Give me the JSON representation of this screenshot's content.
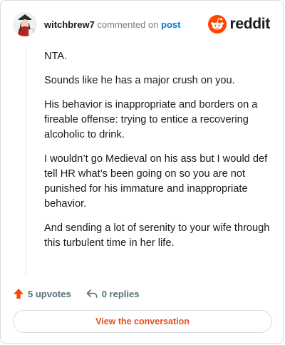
{
  "header": {
    "username": "witchbrew7",
    "verb": "commented on",
    "link": "post",
    "brand_word": "reddit"
  },
  "comment": {
    "paragraphs": [
      "NTA.",
      "Sounds like he has a major crush on you.",
      "His behavior is inappropriate and borders on a fireable offense: trying to entice a recovering alcoholic to drink.",
      "I wouldn’t go Medieval on his ass but I would def tell HR what’s been going on so you are not punished for his immature and inappropriate behavior.",
      "And sending a lot of serenity to your wife through this turbulent time in her life."
    ]
  },
  "actions": {
    "upvotes": "5 upvotes",
    "replies": "0 replies"
  },
  "cta_label": "View the conversation",
  "colors": {
    "brand": "#ff4500",
    "upvote": "#ff4500",
    "link": "#0079d3",
    "cta_text": "#e0501a"
  },
  "icons": {
    "avatar": "avatar",
    "logo": "reddit-logo-icon",
    "upvote": "upvote-arrow-icon",
    "reply": "reply-arrow-icon"
  }
}
